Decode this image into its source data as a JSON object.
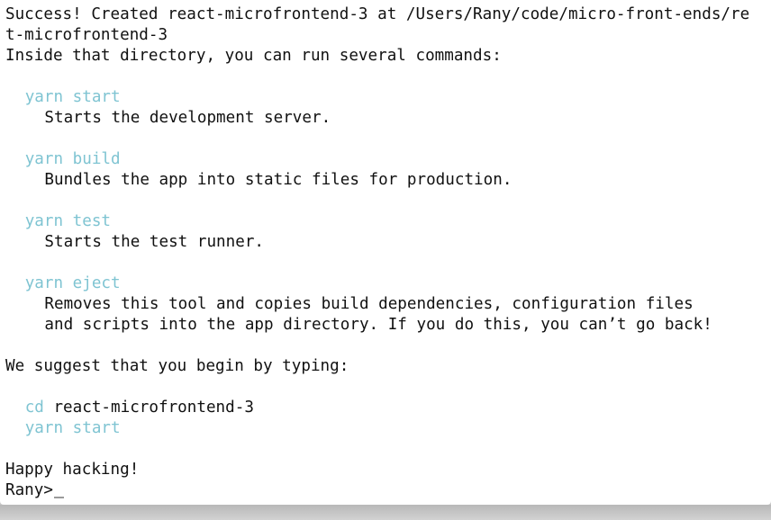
{
  "terminal": {
    "lines": {
      "l1": "Success! Created react-microfrontend-3 at /Users/Rany/code/micro-front-ends/re",
      "l2": "t-microfrontend-3",
      "l3": "Inside that directory, you can run several commands:",
      "cmd_start": "yarn start",
      "desc_start": "Starts the development server.",
      "cmd_build": "yarn build",
      "desc_build": "Bundles the app into static files for production.",
      "cmd_test": "yarn test",
      "desc_test": "Starts the test runner.",
      "cmd_eject": "yarn eject",
      "desc_eject_1": "Removes this tool and copies build dependencies, configuration files",
      "desc_eject_2": "and scripts into the app directory. If you do this, you can’t go back!",
      "suggest": "We suggest that you begin by typing:",
      "cd_cmd": "cd",
      "cd_arg": "react-microfrontend-3",
      "final_start": "yarn start",
      "happy": "Happy hacking!",
      "prompt": "Rany>"
    },
    "colors": {
      "command": "#7fc4d2",
      "text": "#111111",
      "background": "#ffffff"
    }
  }
}
